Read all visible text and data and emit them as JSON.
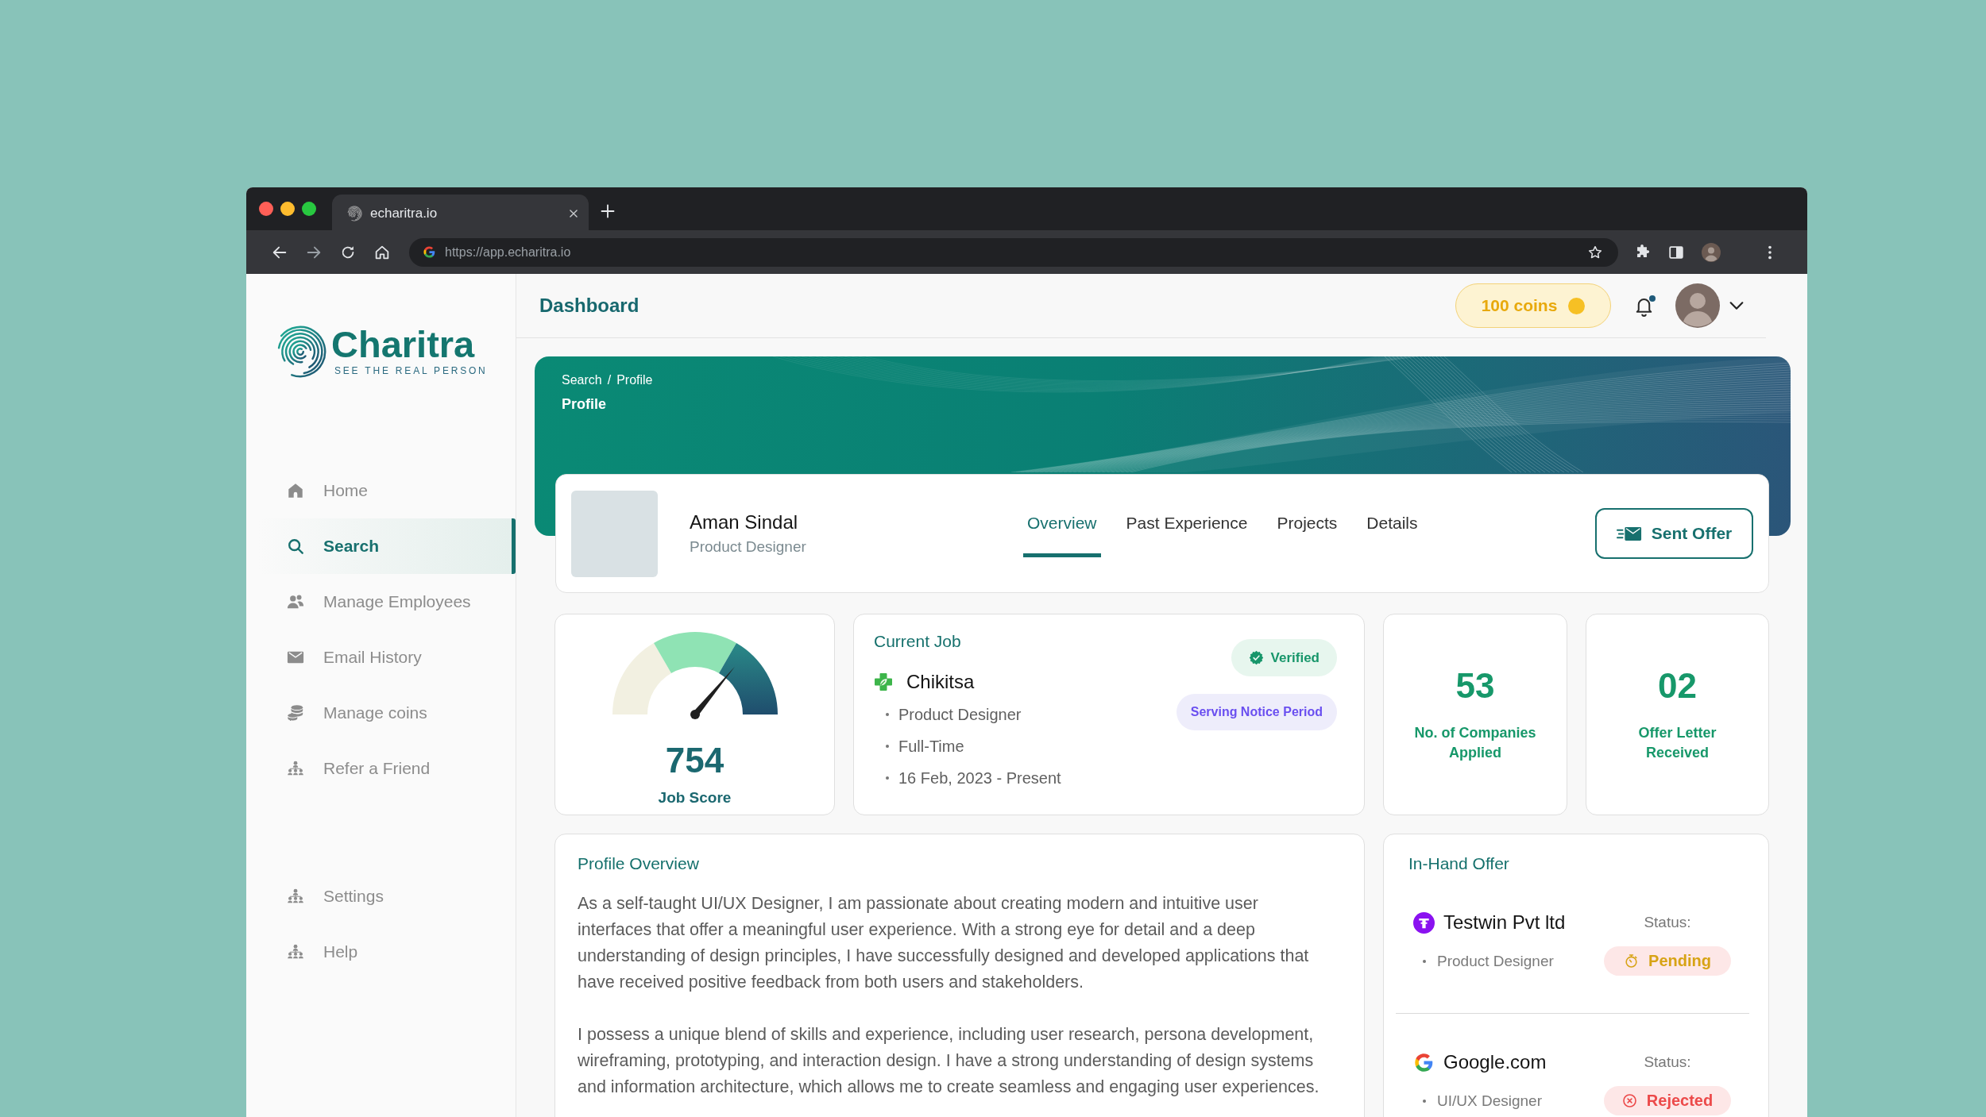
{
  "browser": {
    "tab_title": "echaritra.io",
    "url": "https://app.echaritra.io"
  },
  "sidebar": {
    "brand": {
      "name": "Charitra",
      "tagline": "SEE THE REAL PERSON"
    },
    "nav": [
      {
        "label": "Home",
        "selected": false
      },
      {
        "label": "Search",
        "selected": true
      },
      {
        "label": "Manage Employees",
        "selected": false
      },
      {
        "label": "Email History",
        "selected": false
      },
      {
        "label": "Manage coins",
        "selected": false
      },
      {
        "label": "Refer a Friend",
        "selected": false
      }
    ],
    "bottom_nav": [
      {
        "label": "Settings",
        "selected": false
      },
      {
        "label": "Help",
        "selected": false
      }
    ]
  },
  "header": {
    "title": "Dashboard",
    "coins": "100 coins",
    "notifications_unread": true
  },
  "banner": {
    "breadcrumb": [
      "Search",
      "Profile"
    ],
    "separator": "/",
    "title": "Profile"
  },
  "profile": {
    "name": "Aman Sindal",
    "role": "Product Designer",
    "tabs": [
      {
        "label": "Overview",
        "selected": true
      },
      {
        "label": "Past Experience",
        "selected": false
      },
      {
        "label": "Projects",
        "selected": false
      },
      {
        "label": "Details",
        "selected": false
      }
    ],
    "action": "Sent Offer"
  },
  "score": {
    "value": "754",
    "label": "Job Score",
    "level": 0.72
  },
  "current_job": {
    "title": "Current Job",
    "company": "Chikitsa",
    "details": [
      "Product Designer",
      "Full-Time",
      "16 Feb, 2023 - Present"
    ],
    "badges": [
      {
        "kind": "verified",
        "label": "Verified"
      },
      {
        "kind": "notice",
        "label": "Serving Notice Period"
      }
    ]
  },
  "stats": [
    {
      "value": "53",
      "label": "No. of Companies Applied"
    },
    {
      "value": "02",
      "label": "Offer Letter Received"
    }
  ],
  "overview": {
    "title": "Profile Overview",
    "paragraphs": [
      "As a self-taught UI/UX Designer, I am passionate about creating modern and intuitive user interfaces that offer a meaningful user experience. With a strong eye for detail and a deep understanding of design principles, I have successfully designed and developed applications that have received positive feedback from both users and stakeholders.",
      "I possess a unique blend of skills and experience, including user research, persona development, wireframing, prototyping, and interaction design. I have a strong understanding of design systems and information architecture, which allows me to create seamless and engaging user experiences."
    ]
  },
  "offers": {
    "title": "In-Hand Offer",
    "items": [
      {
        "company": "Testwin Pvt ltd",
        "role": "Product Designer",
        "status_label": "Status:",
        "status": "Pending",
        "kind": "pending"
      },
      {
        "company": "Google.com",
        "role": "UI/UX Designer",
        "status_label": "Status:",
        "status": "Rejected",
        "kind": "rejected"
      }
    ]
  }
}
